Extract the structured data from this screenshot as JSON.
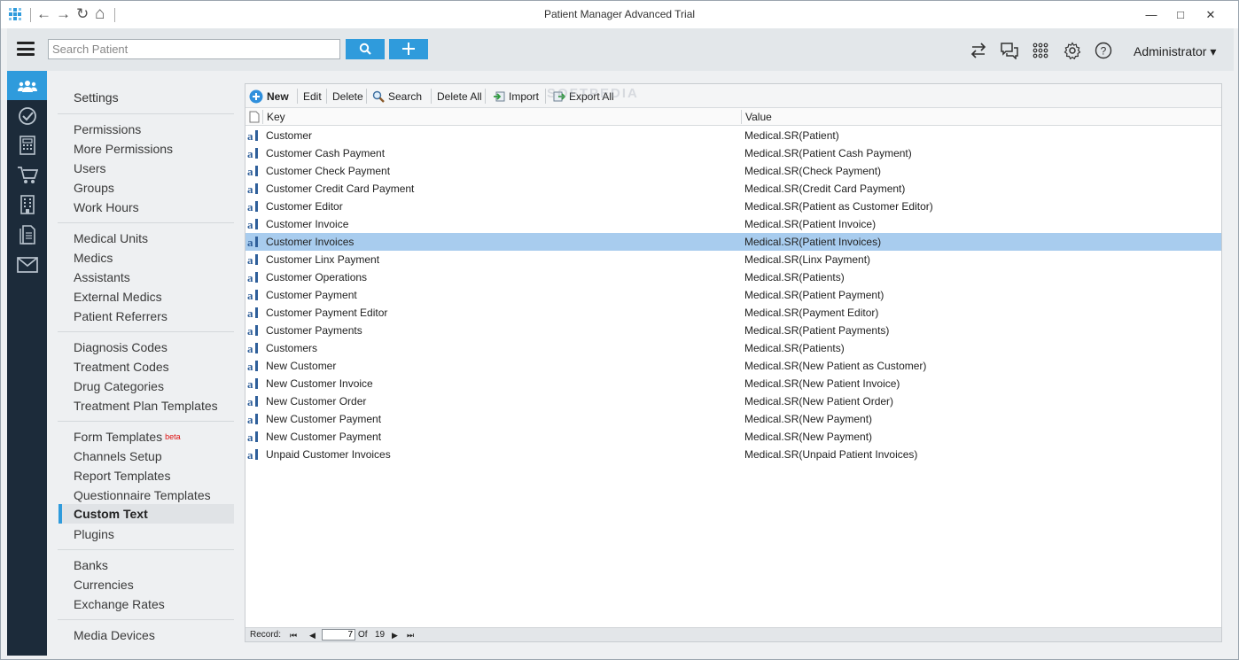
{
  "window": {
    "title": "Patient Manager Advanced Trial",
    "nav_back": "←",
    "nav_forward": "→",
    "nav_refresh": "↻",
    "nav_home": "⌂",
    "minimize": "—",
    "maximize": "□",
    "close": "✕"
  },
  "header": {
    "search_placeholder": "Search Patient",
    "user": "Administrator ▾"
  },
  "sidebar": {
    "heading": "Settings",
    "groups": [
      [
        "Permissions",
        "More Permissions",
        "Users",
        "Groups",
        "Work Hours"
      ],
      [
        "Medical Units",
        "Medics",
        "Assistants",
        "External Medics",
        "Patient Referrers"
      ],
      [
        "Diagnosis Codes",
        "Treatment Codes",
        "Drug Categories",
        "Treatment Plan Templates"
      ],
      [
        "Form Templates",
        "Channels Setup",
        "Report Templates",
        "Questionnaire Templates",
        "Custom Text",
        "Plugins"
      ],
      [
        "Banks",
        "Currencies",
        "Exchange Rates"
      ],
      [
        "Media Devices"
      ]
    ],
    "beta_label": "beta",
    "active_item": "Custom Text"
  },
  "toolbar": {
    "new": "New",
    "edit": "Edit",
    "delete": "Delete",
    "search": "Search",
    "delete_all": "Delete All",
    "import": "Import",
    "export_all": "Export All"
  },
  "watermark": "SOFTPEDIA",
  "grid": {
    "columns": [
      "Key",
      "Value"
    ],
    "selected_index": 6,
    "rows": [
      {
        "key": "Customer",
        "value": "Medical.SR(Patient)"
      },
      {
        "key": "Customer Cash Payment",
        "value": "Medical.SR(Patient Cash Payment)"
      },
      {
        "key": "Customer Check Payment",
        "value": "Medical.SR(Check Payment)"
      },
      {
        "key": "Customer Credit Card Payment",
        "value": "Medical.SR(Credit Card Payment)"
      },
      {
        "key": "Customer Editor",
        "value": "Medical.SR(Patient as Customer Editor)"
      },
      {
        "key": "Customer Invoice",
        "value": "Medical.SR(Patient Invoice)"
      },
      {
        "key": "Customer Invoices",
        "value": "Medical.SR(Patient Invoices)"
      },
      {
        "key": "Customer Linx Payment",
        "value": "Medical.SR(Linx Payment)"
      },
      {
        "key": "Customer Operations",
        "value": "Medical.SR(Patients)"
      },
      {
        "key": "Customer Payment",
        "value": "Medical.SR(Patient Payment)"
      },
      {
        "key": "Customer Payment Editor",
        "value": "Medical.SR(Payment Editor)"
      },
      {
        "key": "Customer Payments",
        "value": "Medical.SR(Patient Payments)"
      },
      {
        "key": "Customers",
        "value": "Medical.SR(Patients)"
      },
      {
        "key": "New Customer",
        "value": "Medical.SR(New Patient as Customer)"
      },
      {
        "key": "New Customer Invoice",
        "value": "Medical.SR(New Patient Invoice)"
      },
      {
        "key": "New Customer Order",
        "value": "Medical.SR(New Patient Order)"
      },
      {
        "key": "New Customer Payment",
        "value": "Medical.SR(New Payment)"
      },
      {
        "key": "New Customer Payment",
        "value": "Medical.SR(New Payment)"
      },
      {
        "key": "Unpaid Customer Invoices",
        "value": "Medical.SR(Unpaid Patient Invoices)"
      }
    ]
  },
  "record_nav": {
    "label": "Record:",
    "current": "7",
    "of_label": "Of",
    "total": "19"
  },
  "colors": {
    "accent": "#2f9bdc",
    "rail": "#1c2b3a",
    "selected_row": "#a8ccee"
  }
}
